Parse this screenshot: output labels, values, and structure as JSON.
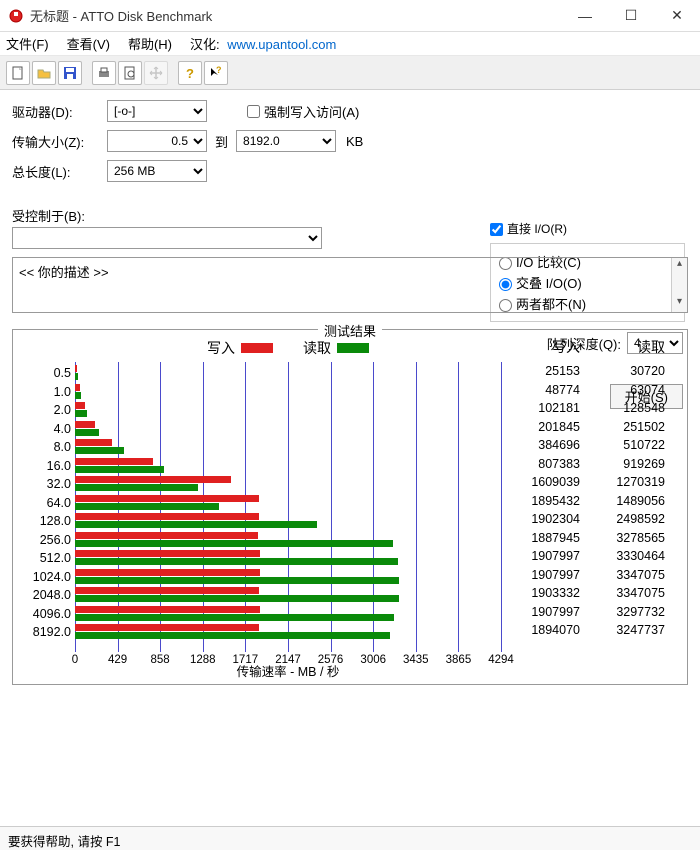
{
  "window": {
    "title": "无标题 - ATTO Disk Benchmark"
  },
  "menus": {
    "file": "文件(F)",
    "view": "查看(V)",
    "help": "帮助(H)",
    "cnlabel": "汉化:",
    "cnlink": "www.upantool.com"
  },
  "form": {
    "drive_label": "驱动器(D):",
    "drive_value": "[-o-]",
    "size_label": "传输大小(Z):",
    "size_from": "0.5",
    "size_to_label": "到",
    "size_to": "8192.0",
    "size_unit": "KB",
    "len_label": "总长度(L):",
    "len_value": "256 MB",
    "force_label": "强制写入访问(A)",
    "direct_label": "直接 I/O(R)",
    "radio_compare": "I/O 比较(C)",
    "radio_overlap": "交叠 I/O(O)",
    "radio_neither": "两者都不(N)",
    "queue_label": "队列深度(Q):",
    "queue_value": "4",
    "controlled_label": "受控制于(B):",
    "start_label": "开始(S)",
    "desc_placeholder": "<<   你的描述    >>"
  },
  "results": {
    "group_title": "测试结果",
    "legend_write": "写入",
    "legend_read": "读取",
    "xlabel": "传输速率 - MB / 秒",
    "col_write": "写入",
    "col_read": "读取"
  },
  "status": {
    "text": "要获得帮助, 请按 F1"
  },
  "chart_data": {
    "type": "bar",
    "categories": [
      "0.5",
      "1.0",
      "2.0",
      "4.0",
      "8.0",
      "16.0",
      "32.0",
      "64.0",
      "128.0",
      "256.0",
      "512.0",
      "1024.0",
      "2048.0",
      "4096.0",
      "8192.0"
    ],
    "series": [
      {
        "name": "写入",
        "values_kb": [
          25153,
          48774,
          102181,
          201845,
          384696,
          807383,
          1609039,
          1895432,
          1902304,
          1887945,
          1907997,
          1907997,
          1903332,
          1907997,
          1894070
        ]
      },
      {
        "name": "读取",
        "values_kb": [
          30720,
          63074,
          128548,
          251502,
          510722,
          919269,
          1270319,
          1489056,
          2498592,
          3278565,
          3330464,
          3347075,
          3347075,
          3297732,
          3247737
        ]
      }
    ],
    "xticks": [
      0,
      429,
      858,
      1288,
      1717,
      2147,
      2576,
      3006,
      3435,
      3865,
      4294
    ],
    "xmax_mb": 4294,
    "ylabel_col1": "写入",
    "ylabel_col2": "读取"
  }
}
